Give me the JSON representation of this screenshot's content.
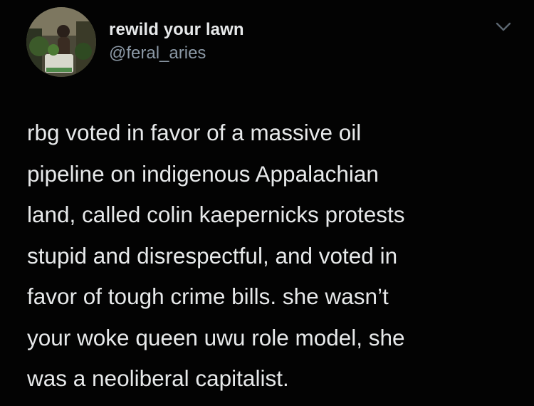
{
  "author": {
    "display_name": "rewild your lawn",
    "handle": "@feral_aries",
    "avatar_icon": "profile-photo-avatar"
  },
  "menu_icon": "chevron-down-icon",
  "tweet": {
    "lines": [
      "rbg voted in favor of a massive oil",
      "pipeline on indigenous Appalachian",
      "land, called colin kaepernicks protests",
      "stupid and disrespectful, and voted in",
      "favor of tough crime bills. she wasn’t",
      "your woke queen uwu role model, she",
      "was a neoliberal capitalist."
    ]
  },
  "colors": {
    "background": "#030303",
    "text": "#e7e9ea",
    "secondary_text": "#8b98a5"
  }
}
